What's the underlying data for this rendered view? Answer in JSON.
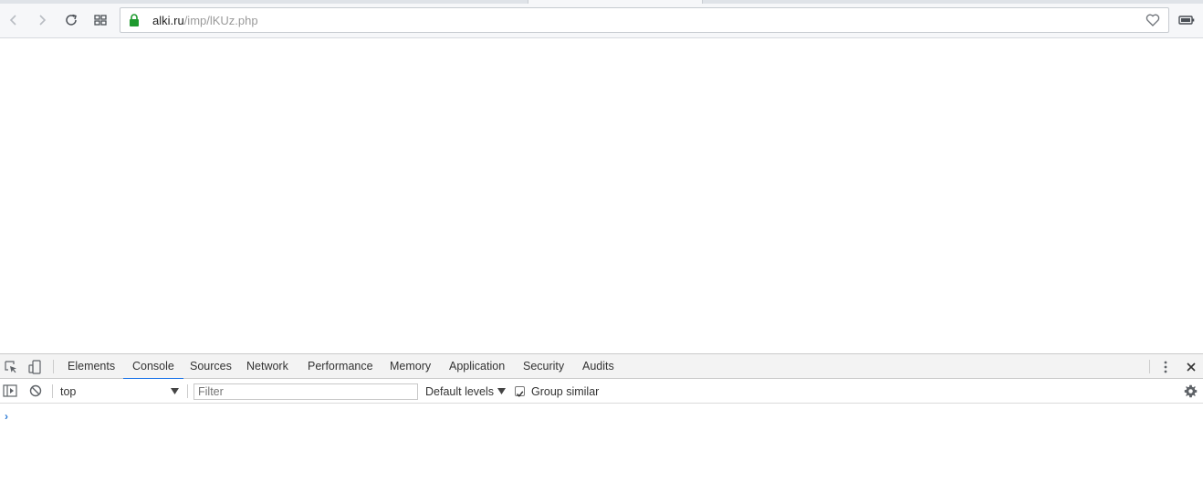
{
  "browser": {
    "url_host": "alki.ru",
    "url_path": "/imp/lKUz.php",
    "toolbar_icons": [
      "back-icon",
      "forward-icon",
      "reload-icon",
      "speed-dial-icon",
      "lock-icon",
      "heart-icon",
      "battery-icon"
    ]
  },
  "devtools": {
    "tabs": [
      {
        "label": "Elements",
        "active": false
      },
      {
        "label": "Console",
        "active": true
      },
      {
        "label": "Sources",
        "active": false
      },
      {
        "label": "Network",
        "active": false
      },
      {
        "label": "Performance",
        "active": false
      },
      {
        "label": "Memory",
        "active": false
      },
      {
        "label": "Application",
        "active": false
      },
      {
        "label": "Security",
        "active": false
      },
      {
        "label": "Audits",
        "active": false
      }
    ],
    "console": {
      "context": "top",
      "filter_placeholder": "Filter",
      "levels_label": "Default levels",
      "group_similar_label": "Group similar",
      "group_similar_checked": true,
      "prompt": "›"
    }
  },
  "colors": {
    "accent": "#1a73e8",
    "lock": "#1e9a2e",
    "prompt": "#2e7bd6"
  }
}
